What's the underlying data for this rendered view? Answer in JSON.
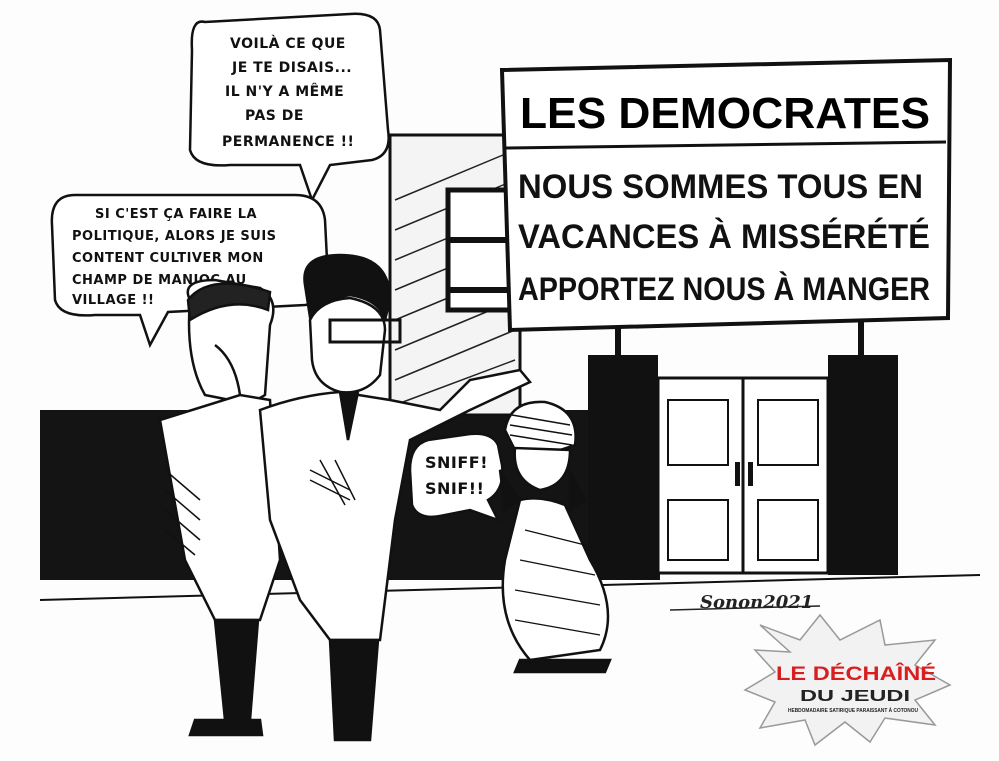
{
  "sign": {
    "title": "LES DEMOCRATES",
    "line1": "NOUS SOMMES TOUS EN",
    "line2": "VACANCES À MISSÉRÉTÉ",
    "line3": "APPORTEZ NOUS À MANGER"
  },
  "bubble_right": {
    "line1": "VOILÀ CE QUE",
    "line2": "JE TE DISAIS...",
    "line3": "IL N'Y A MÊME",
    "line4": "PAS DE",
    "line5": "PERMANENCE !!"
  },
  "bubble_left": {
    "line1": "SI C'EST ÇA FAIRE LA",
    "line2": "POLITIQUE, ALORS JE SUIS",
    "line3": "CONTENT CULTIVER MON",
    "line4": "CHAMP DE MANIOC AU",
    "line5": "VILLAGE !!"
  },
  "bubble_woman": {
    "line1": "SNIFF!",
    "line2": "SNIF!!"
  },
  "signature": "Sonon2021",
  "logo": {
    "line1": "LE DÉCHAÎNÉ",
    "line2": "DU JEUDI",
    "tagline": "HEBDOMADAIRE SATIRIQUE PARAISSANT À COTONOU"
  },
  "colors": {
    "ink": "#111111",
    "paper": "#fdfdfd",
    "logo_red": "#d81e1e"
  }
}
